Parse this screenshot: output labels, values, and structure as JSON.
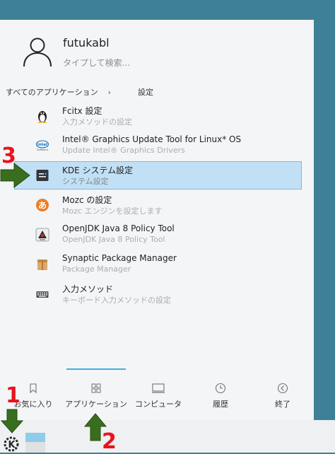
{
  "user": {
    "name": "futukabl",
    "search_placeholder": "タイプして検索..."
  },
  "breadcrumb": {
    "root": "すべてのアプリケーション",
    "separator": "›",
    "current": "設定"
  },
  "apps": [
    {
      "title": "Fcitx 設定",
      "subtitle": "入力メソッドの設定",
      "icon": "penguin-icon"
    },
    {
      "title": "Intel® Graphics Update Tool for Linux* OS",
      "subtitle": "Update Intel® Graphics Drivers",
      "icon": "intel-icon"
    },
    {
      "title": "KDE システム設定",
      "subtitle": "システム設定",
      "icon": "kde-settings-icon",
      "selected": true
    },
    {
      "title": "Mozc の設定",
      "subtitle": "Mozc エンジンを設定します",
      "icon": "mozc-icon"
    },
    {
      "title": "OpenJDK Java 8 Policy Tool",
      "subtitle": "OpenJDK Java 8 Policy Tool",
      "icon": "java-icon"
    },
    {
      "title": "Synaptic Package Manager",
      "subtitle": "Package Manager",
      "icon": "package-icon"
    },
    {
      "title": "入力メソッド",
      "subtitle": "キーボード入力メソッドの設定",
      "icon": "keyboard-icon"
    }
  ],
  "tabs": [
    {
      "label": "お気に入り",
      "icon": "bookmark-icon"
    },
    {
      "label": "アプリケーション",
      "icon": "grid-icon",
      "active": true
    },
    {
      "label": "コンピュータ",
      "icon": "monitor-icon"
    },
    {
      "label": "履歴",
      "icon": "clock-icon"
    },
    {
      "label": "終了",
      "icon": "left-arrow-circle-icon"
    }
  ],
  "annotations": {
    "n1": "1",
    "n2": "2",
    "n3": "3"
  },
  "colors": {
    "desktop": "#3e8196",
    "selection": "#c2e0f5",
    "annotation_number": "#e8141c",
    "annotation_arrow": "#3a6e1f",
    "accent": "#3daee9"
  }
}
